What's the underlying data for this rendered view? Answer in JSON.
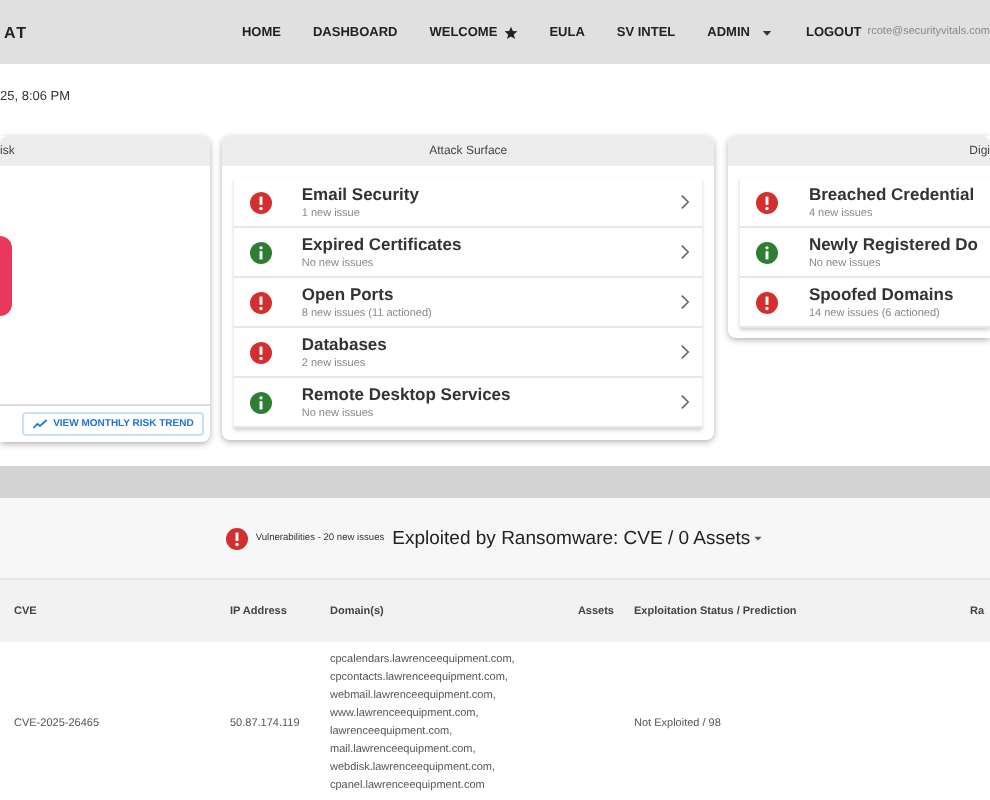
{
  "brand": "AT",
  "nav": [
    {
      "label": "HOME",
      "kind": "link"
    },
    {
      "label": "DASHBOARD",
      "kind": "link"
    },
    {
      "label": "WELCOME",
      "kind": "star"
    },
    {
      "label": "EULA",
      "kind": "link"
    },
    {
      "label": "SV INTEL",
      "kind": "link"
    },
    {
      "label": "ADMIN",
      "kind": "menu"
    },
    {
      "label": "LOGOUT",
      "kind": "link"
    }
  ],
  "user_email": "rcote@securityvitals.com",
  "timestamp": "25, 8:06 PM",
  "risk_card": {
    "title": "isk",
    "button": "VIEW MONTHLY RISK TREND"
  },
  "attack_surface": {
    "title": "Attack Surface",
    "items": [
      {
        "name": "Email Security",
        "detail": "1 new issue",
        "alert": true
      },
      {
        "name": "Expired Certificates",
        "detail": "No new issues",
        "alert": false
      },
      {
        "name": "Open Ports",
        "detail": "8 new issues (11 actioned)",
        "alert": true
      },
      {
        "name": "Databases",
        "detail": "2 new issues",
        "alert": true
      },
      {
        "name": "Remote Desktop Services",
        "detail": "No new issues",
        "alert": false
      }
    ]
  },
  "digital_card": {
    "title": "Digi",
    "items": [
      {
        "name": "Breached Credential",
        "detail": "4 new issues",
        "alert": true
      },
      {
        "name": "Newly Registered Do",
        "detail": "No new issues",
        "alert": false
      },
      {
        "name": "Spoofed Domains",
        "detail": "14 new issues (6 actioned)",
        "alert": true
      }
    ]
  },
  "vulnerabilities": {
    "alert": true,
    "summary": "Vulnerabilities - 20 new issues",
    "heading": "Exploited by Ransomware: CVE / 0 Assets"
  },
  "table": {
    "columns": [
      "CVE",
      "IP Address",
      "Domain(s)",
      "Assets",
      "Exploitation Status / Prediction",
      "Ra"
    ],
    "rows": [
      {
        "cve": "CVE-2025-26465",
        "ip": "50.87.174.119",
        "domains": [
          "cpcalendars.lawrenceequipment.com,",
          "cpcontacts.lawrenceequipment.com,",
          "webmail.lawrenceequipment.com,",
          "www.lawrenceequipment.com,",
          "lawrenceequipment.com,",
          "mail.lawrenceequipment.com,",
          "webdisk.lawrenceequipment.com,",
          "cpanel.lawrenceequipment.com"
        ],
        "assets": "",
        "status": "Not Exploited / 98"
      }
    ]
  }
}
